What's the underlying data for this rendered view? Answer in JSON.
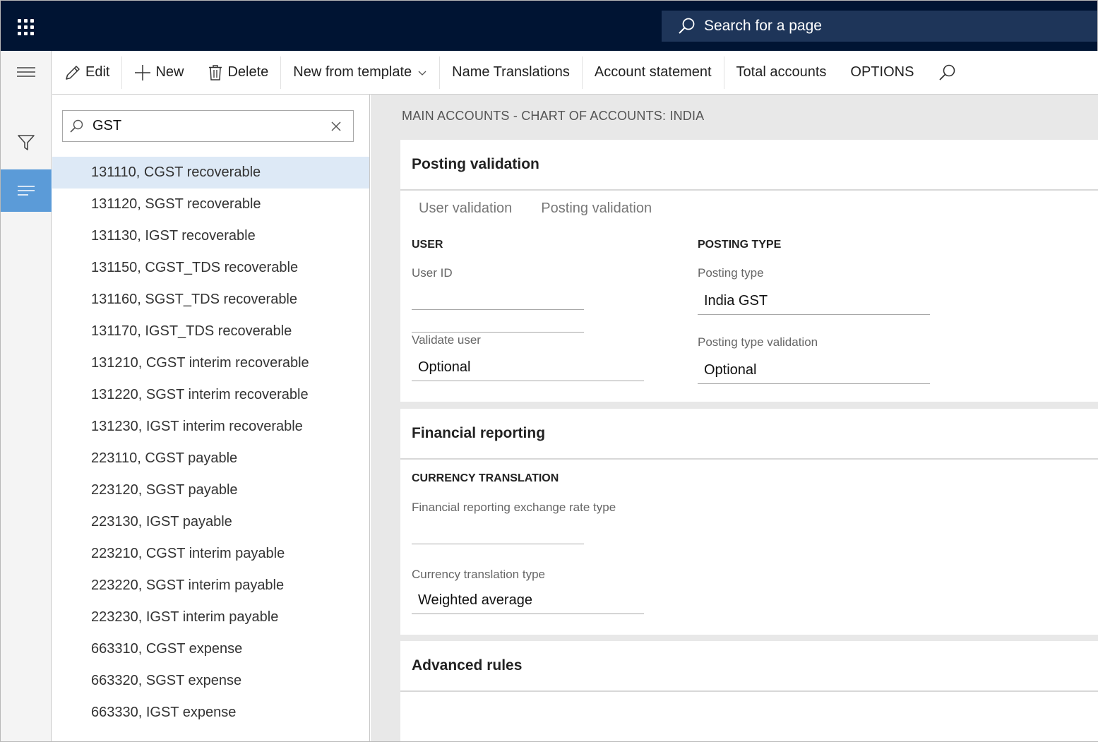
{
  "topbar": {
    "search_label": "Search for a page"
  },
  "actions": {
    "edit": "Edit",
    "new": "New",
    "delete": "Delete",
    "new_from_template": "New from template",
    "name_translations": "Name Translations",
    "account_statement": "Account statement",
    "total_accounts": "Total accounts",
    "options": "OPTIONS"
  },
  "list": {
    "filter_value": "GST",
    "items": [
      "131110, CGST recoverable",
      "131120, SGST recoverable",
      "131130, IGST recoverable",
      "131150, CGST_TDS recoverable",
      "131160, SGST_TDS recoverable",
      "131170, IGST_TDS recoverable",
      "131210, CGST interim recoverable",
      "131220, SGST interim recoverable",
      "131230, IGST interim recoverable",
      "223110, CGST payable",
      "223120, SGST payable",
      "223130, IGST payable",
      "223210, CGST interim payable",
      "223220, SGST interim payable",
      "223230, IGST interim payable",
      "663310, CGST expense",
      "663320, SGST expense",
      "663330, IGST expense"
    ]
  },
  "details": {
    "caption": "MAIN ACCOUNTS - CHART OF ACCOUNTS: INDIA",
    "posting_validation": {
      "header": "Posting validation",
      "tabs": [
        "User validation",
        "Posting validation"
      ],
      "user_group": "USER",
      "user_id_label": "User ID",
      "user_id_value": "",
      "validate_user_label": "Validate user",
      "validate_user_value": "Optional",
      "posting_type_group": "POSTING TYPE",
      "posting_type_label": "Posting type",
      "posting_type_value": "India GST",
      "posting_type_validation_label": "Posting type validation",
      "posting_type_validation_value": "Optional"
    },
    "financial_reporting": {
      "header": "Financial reporting",
      "group": "CURRENCY TRANSLATION",
      "exchange_rate_label": "Financial reporting exchange rate type",
      "exchange_rate_value": "",
      "currency_translation_label": "Currency translation type",
      "currency_translation_value": "Weighted average"
    },
    "advanced_rules": {
      "header": "Advanced rules"
    }
  }
}
